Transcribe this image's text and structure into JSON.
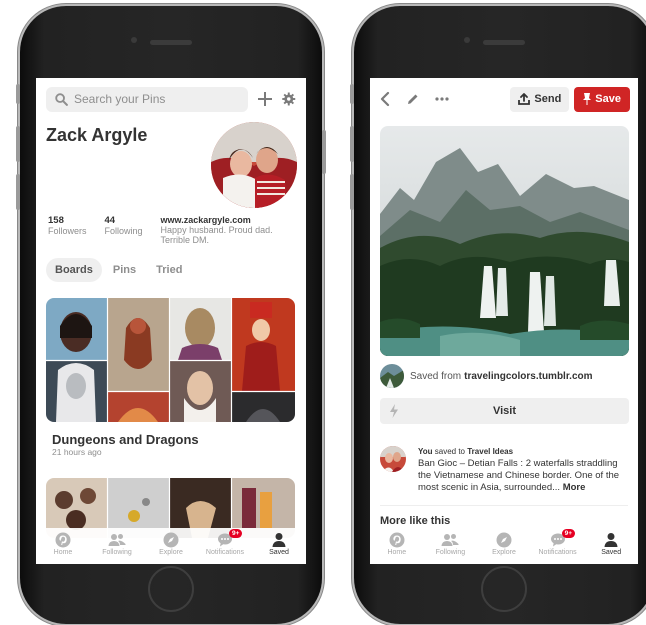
{
  "left_screen": {
    "search_placeholder": "Search your Pins",
    "profile": {
      "name": "Zack Argyle",
      "followers_count": "158",
      "followers_label": "Followers",
      "following_count": "44",
      "following_label": "Following",
      "website": "www.zackargyle.com",
      "bio": "Happy husband. Proud dad. Terrible DM."
    },
    "tabs": [
      "Boards",
      "Pins",
      "Tried"
    ],
    "active_tab": "Boards",
    "board": {
      "title": "Dungeons and Dragons",
      "time": "21 hours ago"
    },
    "nav": [
      {
        "label": "Home",
        "icon": "pinterest-icon"
      },
      {
        "label": "Following",
        "icon": "people-icon"
      },
      {
        "label": "Explore",
        "icon": "compass-icon"
      },
      {
        "label": "Notifications",
        "icon": "chat-bubble-icon",
        "badge": "9+"
      },
      {
        "label": "Saved",
        "icon": "person-icon"
      }
    ]
  },
  "right_screen": {
    "send_label": "Send",
    "save_label": "Save",
    "saved_from_prefix": "Saved from",
    "saved_from_source": "travelingcolors.tumblr.com",
    "visit_label": "Visit",
    "activity": {
      "user": "You",
      "action": "saved to",
      "board": "Travel Ideas",
      "description": "Ban Gioc – Detian Falls : 2 waterfalls straddling the Vietnamese and Chinese border. One of the most scenic in Asia, surrounded...",
      "more": "More"
    },
    "more_like_this": "More like this",
    "nav": [
      {
        "label": "Home",
        "icon": "pinterest-icon"
      },
      {
        "label": "Following",
        "icon": "people-icon"
      },
      {
        "label": "Explore",
        "icon": "compass-icon"
      },
      {
        "label": "Notifications",
        "icon": "chat-bubble-icon",
        "badge": "9+"
      },
      {
        "label": "Saved",
        "icon": "person-icon"
      }
    ]
  },
  "colors": {
    "brand_red": "#e60023",
    "save_button": "#d02525",
    "muted_text": "#8e8e8e",
    "chip_bg": "#efefef"
  }
}
